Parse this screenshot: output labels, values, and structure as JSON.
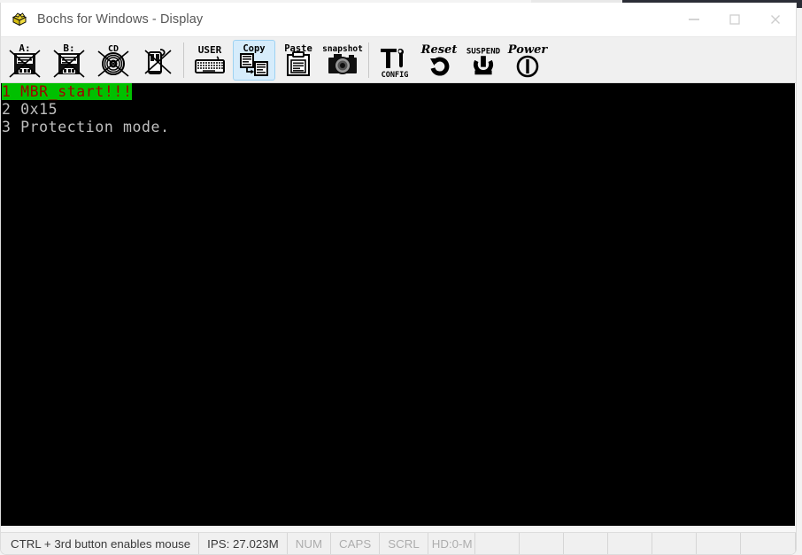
{
  "window": {
    "title": "Bochs for Windows - Display",
    "icon": "bochs-logo-icon",
    "controls": [
      {
        "name": "minimize-button",
        "glyph": "minimize-icon"
      },
      {
        "name": "maximize-button",
        "glyph": "maximize-icon"
      },
      {
        "name": "close-button",
        "glyph": "close-icon"
      }
    ]
  },
  "toolbar": {
    "buttons": [
      {
        "name": "floppy-a-button",
        "icon": "floppy-a-disabled-icon",
        "label": "A:",
        "state": "normal"
      },
      {
        "name": "floppy-b-button",
        "icon": "floppy-b-disabled-icon",
        "label": "B:",
        "state": "normal"
      },
      {
        "name": "cdrom-button",
        "icon": "cd-disabled-icon",
        "label": "CD",
        "state": "normal"
      },
      {
        "name": "mouse-button",
        "icon": "mouse-disabled-icon",
        "label": "",
        "state": "normal"
      },
      {
        "name": "user-button",
        "icon": "user-keyboard-icon",
        "label": "USER",
        "state": "normal"
      },
      {
        "name": "copy-button",
        "icon": "copy-icon",
        "label": "Copy",
        "state": "hover"
      },
      {
        "name": "paste-button",
        "icon": "paste-icon",
        "label": "Paste",
        "state": "normal"
      },
      {
        "name": "snapshot-button",
        "icon": "snapshot-camera-icon",
        "label": "snapshot",
        "state": "normal"
      },
      {
        "name": "config-button",
        "icon": "config-tools-icon",
        "label": "CONFIG",
        "state": "normal"
      },
      {
        "name": "reset-button",
        "icon": "reset-arrow-icon",
        "label": "Reset",
        "state": "normal"
      },
      {
        "name": "suspend-button",
        "icon": "suspend-icon",
        "label": "SUSPEND",
        "state": "normal"
      },
      {
        "name": "power-button",
        "icon": "power-icon",
        "label": "Power",
        "state": "normal"
      }
    ]
  },
  "display": {
    "background_color": "#000000",
    "lines": [
      {
        "segments": [
          {
            "text": "1 MBR_start!!!",
            "fg": "#a00000",
            "bg": "#00c000"
          }
        ]
      },
      {
        "segments": [
          {
            "text": "2 0x15",
            "fg": "#bfbfbf",
            "bg": "transparent"
          }
        ]
      },
      {
        "segments": [
          {
            "text": "3 Protection mode.",
            "fg": "#bfbfbf",
            "bg": "transparent"
          }
        ]
      }
    ]
  },
  "statusbar": {
    "cells": [
      {
        "name": "status-hint",
        "text": "CTRL + 3rd button enables mouse",
        "dim": false
      },
      {
        "name": "status-ips",
        "text": "IPS: 27.023M",
        "dim": false
      },
      {
        "name": "status-num-lock",
        "text": "NUM",
        "dim": true
      },
      {
        "name": "status-caps-lock",
        "text": "CAPS",
        "dim": true
      },
      {
        "name": "status-scroll-lock",
        "text": "SCRL",
        "dim": true
      },
      {
        "name": "status-hd-activity",
        "text": "HD:0-M",
        "dim": true
      }
    ],
    "empty_cell_count": 6
  },
  "colors": {
    "toolbar_bg": "#f0f0f0",
    "titlebar_bg": "#ffffff",
    "hover_highlight": "#d6ecfb",
    "vga_black": "#000000",
    "vga_green": "#00c000",
    "vga_red": "#a00000",
    "vga_gray": "#bfbfbf"
  }
}
